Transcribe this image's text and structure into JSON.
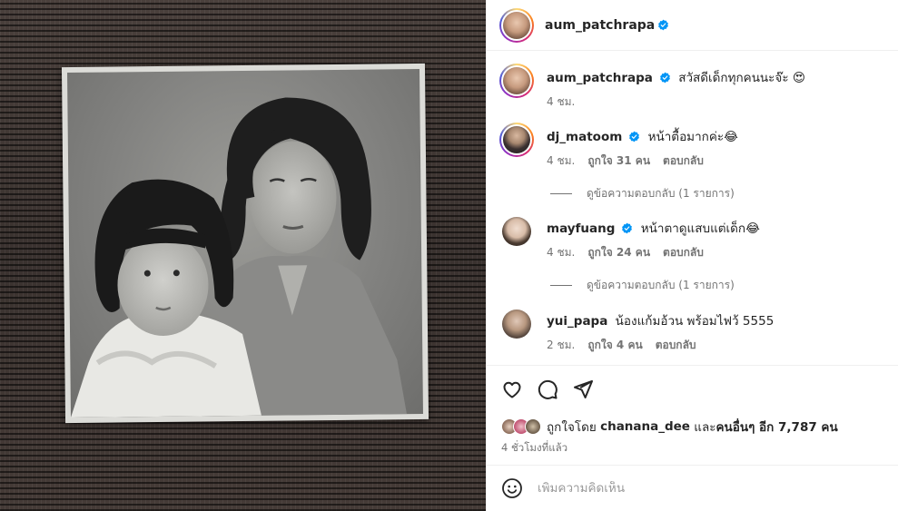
{
  "post": {
    "author": "aum_patchrapa",
    "caption": "สวัสดีเด็กทุกคนนะจ๊ะ 😍",
    "caption_time": "4 ชม.",
    "likes_prefix": "ถูกใจโดย",
    "liked_by": "chanana_dee",
    "likes_mid": "และ",
    "likes_others": "คนอื่นๆ อีก 7,787 คน",
    "posted_ago": "4 ชั่วโมงที่แล้ว"
  },
  "comments": [
    {
      "username": "dj_matoom",
      "verified": true,
      "text": "หน้าตื้อมากค่ะ😂",
      "time": "4 ชม.",
      "likes": "ถูกใจ 31 คน",
      "reply": "ตอบกลับ",
      "view_replies": "ดูข้อความตอบกลับ (1 รายการ)"
    },
    {
      "username": "mayfuang",
      "verified": true,
      "text": "หน้าตาดูแสบแต่เด็ก😂",
      "time": "4 ชม.",
      "likes": "ถูกใจ 24 คน",
      "reply": "ตอบกลับ",
      "view_replies": "ดูข้อความตอบกลับ (1 รายการ)"
    },
    {
      "username": "yui_papa",
      "verified": false,
      "text": "น้องแก้มอ้วน พร้อมไฟว้ 5555",
      "time": "2 ชม.",
      "likes": "ถูกใจ 4 คน",
      "reply": "ตอบกลับ"
    }
  ],
  "add_comment": {
    "placeholder": "เพิ่มความคิดเห็น"
  },
  "colors": {
    "verified": "#0095f6",
    "muted": "#737373",
    "text": "#262626"
  }
}
